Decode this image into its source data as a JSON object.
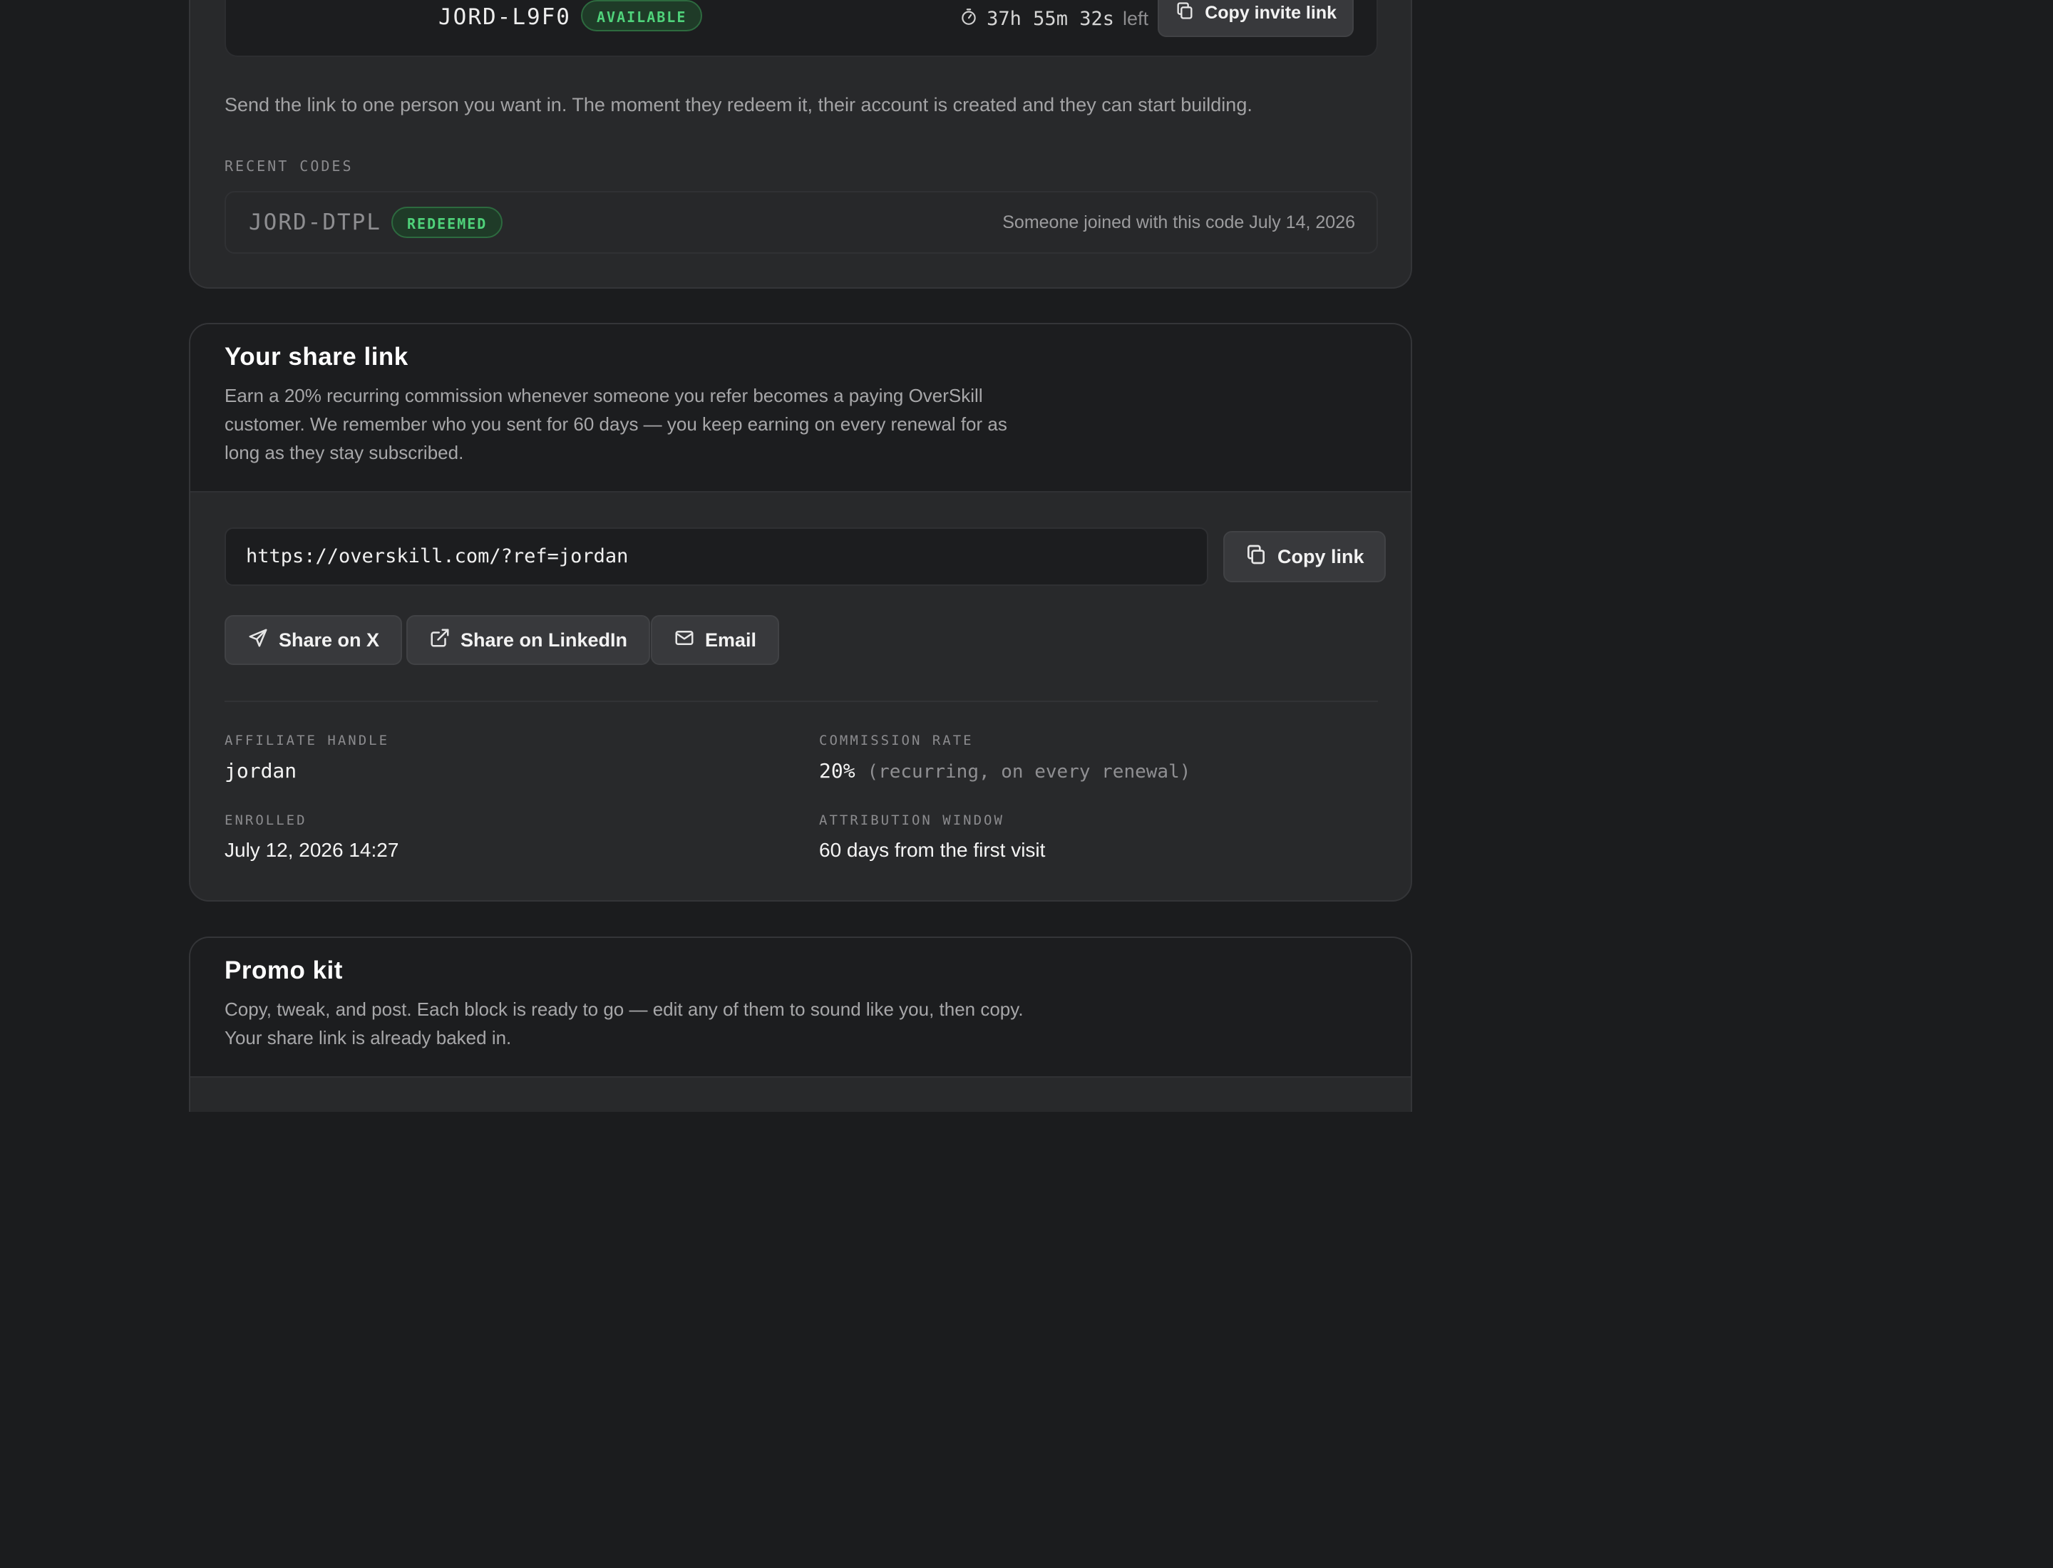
{
  "invite": {
    "active_code": "JORD-L9F0",
    "active_status": "AVAILABLE",
    "timer": "37h 55m 32s",
    "timer_suffix": "left",
    "copy_invite_label": "Copy invite link",
    "description": "Send the link to one person you want in. The moment they redeem it, their account is created and they can start building.",
    "recent_label": "RECENT CODES",
    "recent": [
      {
        "code": "JORD-DTPL",
        "status": "REDEEMED",
        "note": "Someone joined with this code July 14, 2026"
      }
    ]
  },
  "share": {
    "title": "Your share link",
    "description_lines": [
      "Earn a 20% recurring commission whenever someone you refer becomes a paying OverSkill",
      "customer. We remember who you sent for 60 days — you keep earning on every renewal for as",
      "long as they stay subscribed."
    ],
    "url": "https://overskill.com/?ref=jordan",
    "copy_link_label": "Copy link",
    "share_x_label": "Share on X",
    "share_linkedin_label": "Share on LinkedIn",
    "email_label": "Email",
    "fields": {
      "handle_label": "AFFILIATE HANDLE",
      "handle_value": "jordan",
      "rate_label": "COMMISSION RATE",
      "rate_value": "20%",
      "rate_note": "(recurring, on every renewal)",
      "enrolled_label": "ENROLLED",
      "enrolled_value": "July 12, 2026 14:27",
      "window_label": "ATTRIBUTION WINDOW",
      "window_value": "60 days from the first visit"
    }
  },
  "promo": {
    "title": "Promo kit",
    "description_lines": [
      "Copy, tweak, and post. Each block is ready to go — edit any of them to sound like you, then copy.",
      "Your share link is already baked in."
    ]
  },
  "colors": {
    "background": "#1b1c1e",
    "card": "#28292b",
    "card_header": "#1c1d1f",
    "success": "#4fd27a"
  }
}
